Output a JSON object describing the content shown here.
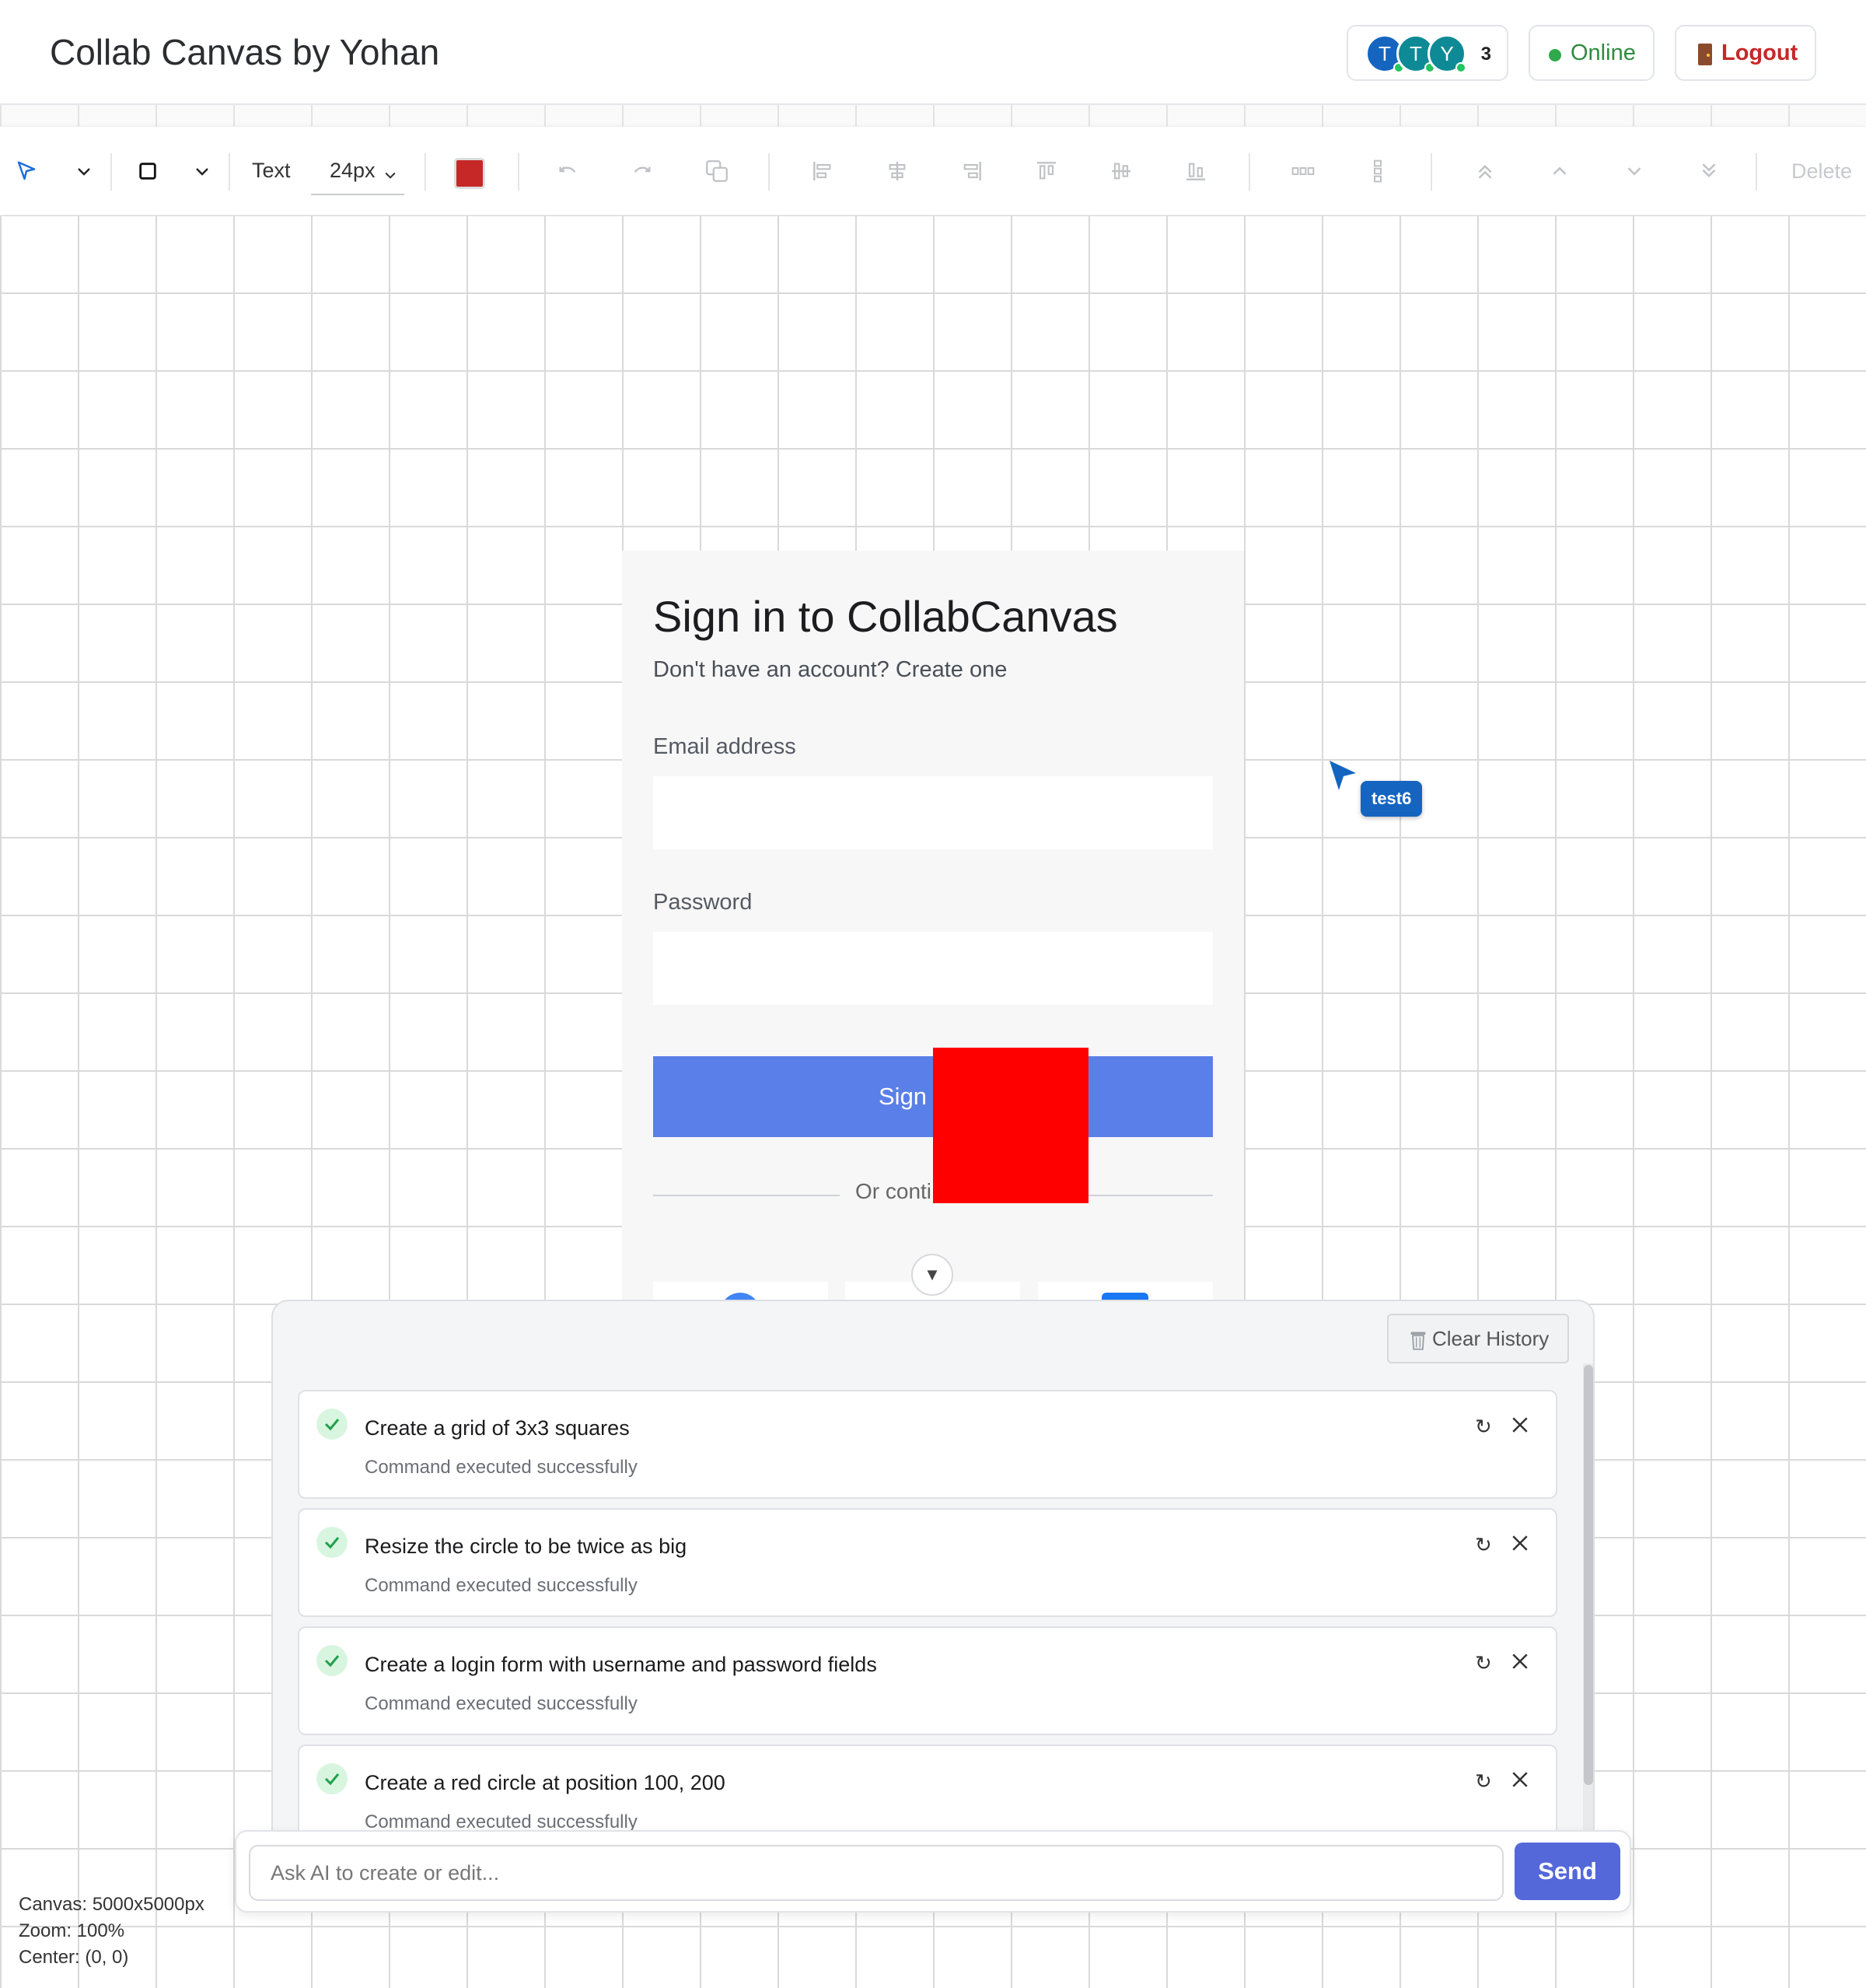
{
  "header": {
    "title": "Collab Canvas by Yohan",
    "presence": {
      "avatars": [
        {
          "initial": "T",
          "color": "#1565c0"
        },
        {
          "initial": "T",
          "color": "#0e8a96"
        },
        {
          "initial": "Y",
          "color": "#0e8a96"
        }
      ],
      "count": "3"
    },
    "status": "Online",
    "logout_label": "Logout"
  },
  "toolbar": {
    "text_label": "Text",
    "font_size": "24px",
    "fill_color": "#c62828",
    "delete_label": "Delete"
  },
  "signin_card": {
    "title": "Sign in to CollabCanvas",
    "subtitle": "Don't have an account? Create one",
    "email_label": "Email address",
    "password_label": "Password",
    "button_label": "Sign",
    "divider_text": "Or conti"
  },
  "remote_cursor": {
    "user": "test6",
    "color": "#1565c0"
  },
  "ai_panel": {
    "clear_label": "Clear History",
    "history": [
      {
        "command": "Create a grid of 3x3 squares",
        "status": "Command executed successfully"
      },
      {
        "command": "Resize the circle to be twice as big",
        "status": "Command executed successfully"
      },
      {
        "command": "Create a login form with username and password fields",
        "status": "Command executed successfully"
      },
      {
        "command": "Create a red circle at position 100, 200",
        "status": "Command executed successfully"
      }
    ],
    "input_placeholder": "Ask AI to create or edit...",
    "send_label": "Send"
  },
  "canvas_info": {
    "size": "Canvas: 5000x5000px",
    "zoom": "Zoom: 100%",
    "center": "Center: (0, 0)"
  }
}
